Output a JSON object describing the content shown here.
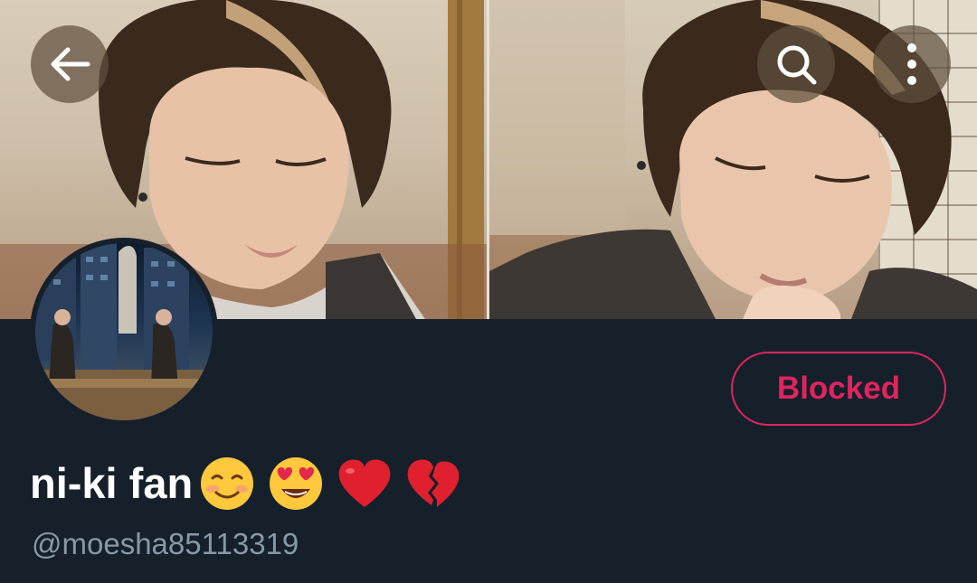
{
  "header": {
    "back_icon": "arrow-left-icon",
    "search_icon": "search-icon",
    "more_icon": "more-vertical-icon"
  },
  "profile": {
    "display_name": "ni-ki fan",
    "name_emojis": [
      "smiling-face-emoji",
      "heart-eyes-emoji",
      "red-heart-emoji",
      "broken-heart-emoji"
    ],
    "handle": "@moesha85113319",
    "blocked_label": "Blocked"
  },
  "colors": {
    "background": "#15202b",
    "blocked_accent": "#e0245e",
    "handle_text": "#8899a6",
    "name_text": "#ffffff"
  }
}
